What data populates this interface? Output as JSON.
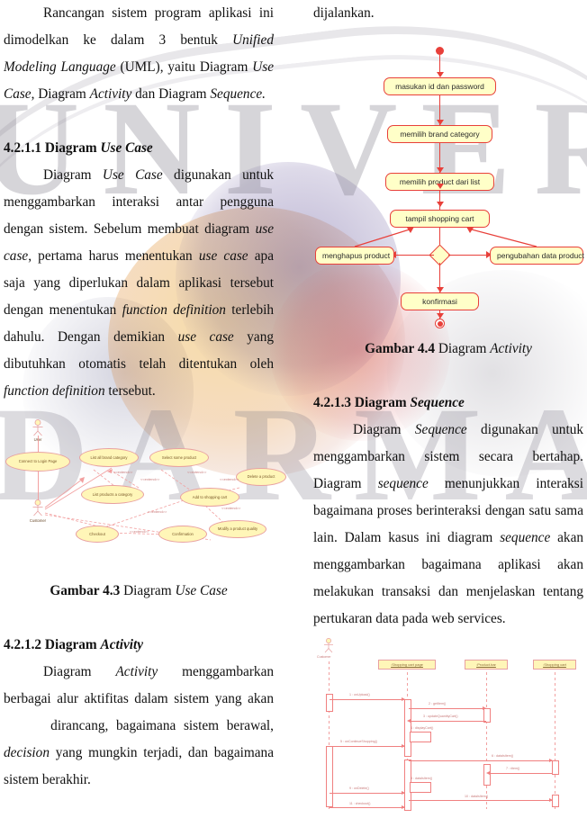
{
  "document": {
    "left_column": {
      "para1": "Rancangan sistem program aplikasi ini dimodelkan ke dalam 3 bentuk Unified Modeling Language (UML), yaitu Diagram Use Case, Diagram Activity dan Diagram Sequence.",
      "heading_use_case": "4.2.1.1 Diagram Use Case",
      "para2": "Diagram Use Case digunakan untuk menggambarkan interaksi antar pengguna dengan sistem. Sebelum membuat diagram use case, pertama harus menentukan use case apa saja yang diperlukan dalam aplikasi tersebut dengan menentukan function definition terlebih dahulu. Dengan demikian use case yang dibutuhkan otomatis telah ditentukan oleh function definition tersebut.",
      "caption_43_bold": "Gambar 4.3",
      "caption_43_rest": "Diagram",
      "caption_43_italic": "Use Case",
      "heading_activity": "4.2.1.2 Diagram Activity",
      "para3": "Diagram Activity menggambarkan berbagai alur aktifitas dalam sistem yang akan dirancang, bagaimana sistem berawal, decision yang mungkin terjadi, dan bagaimana sistem berakhir."
    },
    "right_column": {
      "para_top": "dijalankan.",
      "caption_44_bold": "Gambar 4.4",
      "caption_44_rest": "Diagram",
      "caption_44_italic": "Activity",
      "heading_sequence": "4.2.1.3 Diagram Sequence",
      "para4": "Diagram Sequence digunakan untuk menggambarkan sistem secara bertahap. Diagram sequence menunjukkan interaksi bagaimana proses berinteraksi dengan satu sama lain. Dalam kasus ini diagram sequence akan menggambarkan bagaimana aplikasi akan melakukan transaksi dan menjelaskan tentang pertukaran data pada web services."
    }
  },
  "watermark": {
    "line1": "UNIVER",
    "line2": "DARMA"
  },
  "activity_diagram": {
    "nodes": [
      "masukan id dan password",
      "memilih brand category",
      "memilih product dari list",
      "tampil shopping cart",
      "menghapus product",
      "pengubahan data product",
      "konfirmasi"
    ],
    "node_fill": "#FFFFC8",
    "node_border": "#E8403A"
  },
  "usecase_diagram": {
    "actors": [
      "User",
      "Customer"
    ],
    "usecases": [
      "Connect to Login Page",
      "List all brand category",
      "Select some product",
      "List products a category",
      "Add to shopping cart",
      "Delete a product",
      "Checkout",
      "Confirmation",
      "Modify a product quality"
    ],
    "stereotype": "<<extend>>",
    "fill": "#FFF6B8",
    "border": "#E8A0A0"
  },
  "sequence_diagram": {
    "actor": "Customer",
    "lifelines": [
      ":Shopping cart page",
      ":Product.bar",
      ":Shopping cart"
    ],
    "messages": [
      "1 : onUpload()",
      "2 : getItem()",
      "3 : updateQuantityCart()",
      "4 : displayCart()",
      "5 : onContinueShopping()",
      "6 : dataIsItem()",
      "7 : ritem()",
      "8 : dataIsItem()",
      "9 : onDelete()",
      "10 : dataIsItem()",
      "11 : checkout()"
    ]
  }
}
